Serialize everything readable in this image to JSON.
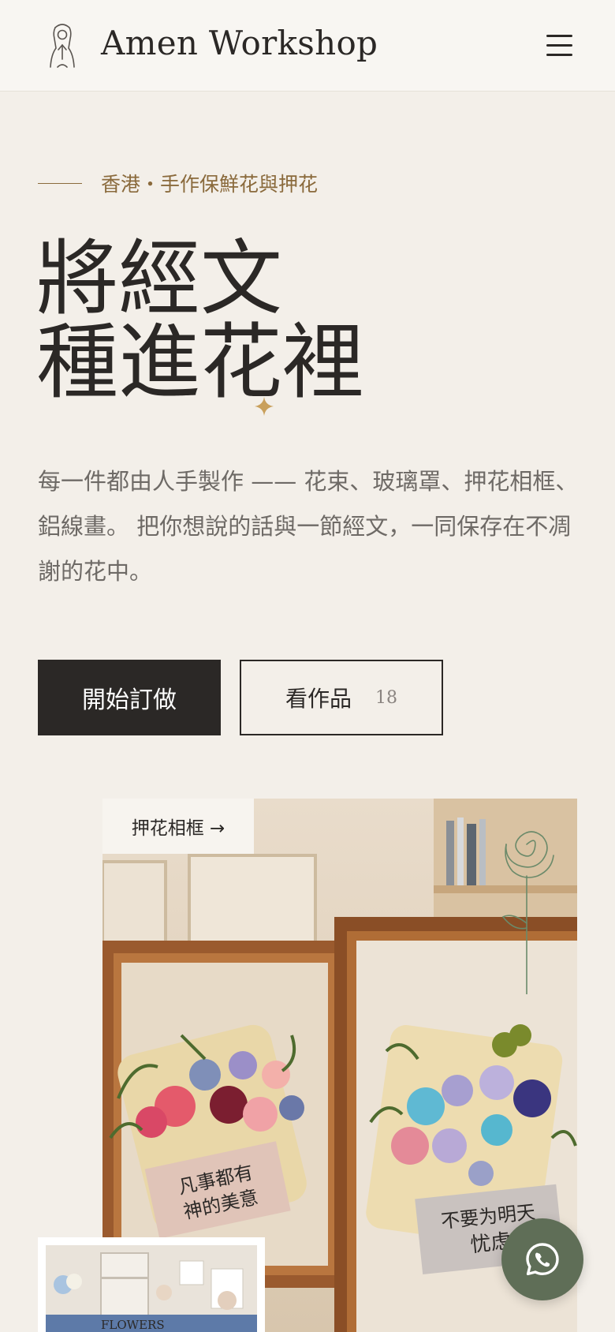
{
  "header": {
    "brand": "Amen Workshop",
    "logo_icon": "praying-figure-logo-icon",
    "menu_icon": "hamburger-menu-icon"
  },
  "hero": {
    "eyebrow": "香港・手作保鮮花與押花",
    "title_line1": "將經文",
    "title_line2": "種進花裡",
    "description": "每一件都由人手製作 —— 花束、玻璃罩、押花相框、鋁線畫。 把你想說的話與一節經文，一同保存在不凋謝的花中。",
    "primary_button": "開始訂做",
    "secondary_button": "看作品",
    "works_count": "18"
  },
  "gallery": {
    "featured_tag": "押花相框 →",
    "frame_left_text": "凡事都有神的美意",
    "frame_right_text": "不要为明天忧虑",
    "secondary_photo_text": "FLOWERS"
  },
  "floating": {
    "whatsapp_icon": "whatsapp-icon"
  },
  "colors": {
    "background": "#f3efe9",
    "accent": "#8a6a3c",
    "dark": "#2b2826",
    "whatsapp": "#5f6e57"
  }
}
